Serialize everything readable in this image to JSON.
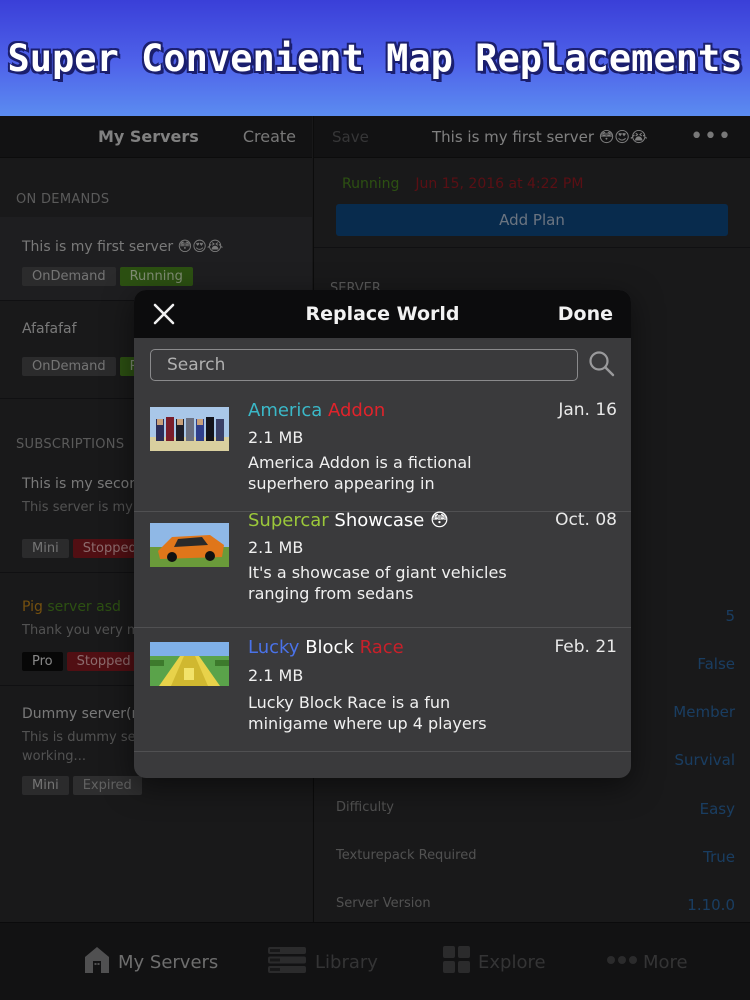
{
  "banner": {
    "title": "Super Convenient Map Replacements"
  },
  "left": {
    "header_title": "My Servers",
    "create_label": "Create",
    "on_demands_label": "ON DEMANDS",
    "subscriptions_label": "SUBSCRIPTIONS",
    "on_demands": [
      {
        "name": "This is my first server 😳😍😭",
        "tags": [
          "OnDemand",
          "Running"
        ]
      },
      {
        "name": "Afafafaf",
        "tags": [
          "OnDemand",
          "Running"
        ]
      }
    ],
    "subscriptions": [
      {
        "name": "This is my second server",
        "desc": "This server is my second server (Main)",
        "tags": [
          "Mini",
          "Stopped"
        ]
      },
      {
        "name_a": "Pig",
        "name_b": "server asd",
        "desc": "Thank you very much for this",
        "tags": [
          "Pro",
          "Stopped"
        ]
      },
      {
        "name": "Dummy server(not working..)",
        "desc": "This is dummy server. It my not working...",
        "tags": [
          "Mini",
          "Expired"
        ]
      }
    ]
  },
  "right": {
    "save_label": "Save",
    "header_title": "This is my first server 😳😍😭",
    "more_label": "•••",
    "status": "Running",
    "status_date": "Jun 15, 2016 at 4:22 PM",
    "add_plan_label": "Add Plan",
    "server_label": "SERVER",
    "rows": [
      {
        "k": "",
        "v": "5"
      },
      {
        "k": "",
        "v": "False"
      },
      {
        "k": "",
        "v": "Member"
      },
      {
        "k": "",
        "v": "Survival"
      },
      {
        "k": "Difficulty",
        "v": "Easy"
      },
      {
        "k": "Texturepack Required",
        "v": "True"
      },
      {
        "k": "Server Version",
        "v": "1.10.0"
      }
    ]
  },
  "modal": {
    "title": "Replace World",
    "done_label": "Done",
    "search_placeholder": "Search",
    "items": [
      {
        "name_a": "America",
        "name_b": "Addon",
        "date": "Jan. 16",
        "size": "2.1 MB",
        "desc": "America Addon is a fictional superhero appearing in"
      },
      {
        "name_a": "Supercar",
        "name_b": "Showcase 😳",
        "date": "Oct. 08",
        "size": "2.1 MB",
        "desc": "It's a showcase of giant vehicles ranging from sedans"
      },
      {
        "name_a": "Lucky",
        "name_b": "Block",
        "name_c": "Race",
        "date": "Feb. 21",
        "size": "2.1 MB",
        "desc": "Lucky Block Race is a fun minigame where up 4 players"
      }
    ]
  },
  "tabbar": {
    "tabs": [
      {
        "label": "My Servers",
        "icon": "home-icon"
      },
      {
        "label": "Library",
        "icon": "library-icon"
      },
      {
        "label": "Explore",
        "icon": "grid-icon"
      },
      {
        "label": "More",
        "icon": "more-icon"
      }
    ]
  },
  "colors": {
    "banner_top": "#3a3fd8",
    "running_green": "#4d8b1f",
    "stopped_red": "#8c1a21",
    "value_blue": "#2c6aa8",
    "america_cyan": "#3ab8c8",
    "addon_red": "#e0232b",
    "supercar_green": "#9bc83a",
    "lucky_blue": "#4a72e8"
  }
}
